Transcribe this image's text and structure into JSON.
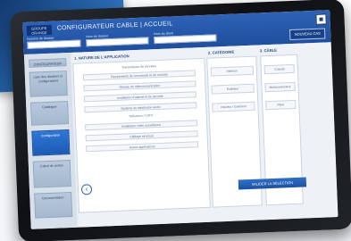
{
  "header": {
    "logo_text": "GROUPE ORANGE",
    "title": "CONFIGURATEUR CABLE | ACCUEIL",
    "fields": [
      {
        "label": "Numéro de dossier",
        "value": ""
      },
      {
        "label": "Nom du dossier",
        "value": ""
      },
      {
        "label": "Nom du client",
        "value": ""
      }
    ],
    "new_case_label": "NOUVEAU CAS"
  },
  "sidebar": {
    "items": [
      {
        "label": "CONFIGURATEUR"
      },
      {
        "label": "Liste des dossiers et configurations"
      },
      {
        "label": "Catalogue"
      },
      {
        "label": "Configuration"
      },
      {
        "label": "Calcul de pertes"
      },
      {
        "label": "Documentation"
      }
    ],
    "active_index": 3
  },
  "columns": {
    "application": {
      "title": "1. NATURE DE L'APPLICATION",
      "options": [
        "Transmission de données",
        "Équipements de commande et de contrôle",
        "Réseau de télécommunication",
        "Installation d'alarme et de sécurité",
        "Système de distribution audio",
        "Télévision / CATV",
        "Installation vidéo surveillance",
        "Câblage structuré",
        "Autres applications"
      ]
    },
    "category": {
      "title": "2. CATÉGORIE",
      "options": [
        "Intérieur",
        "Extérieur",
        "Intérieur / Extérieur"
      ]
    },
    "cable": {
      "title": "3. CÂBLE",
      "options": [
        "Coaxial",
        "Multiconducteur",
        "Fibre"
      ]
    }
  },
  "footer": {
    "validate_label": "VALIDER LA SÉLECTION"
  }
}
